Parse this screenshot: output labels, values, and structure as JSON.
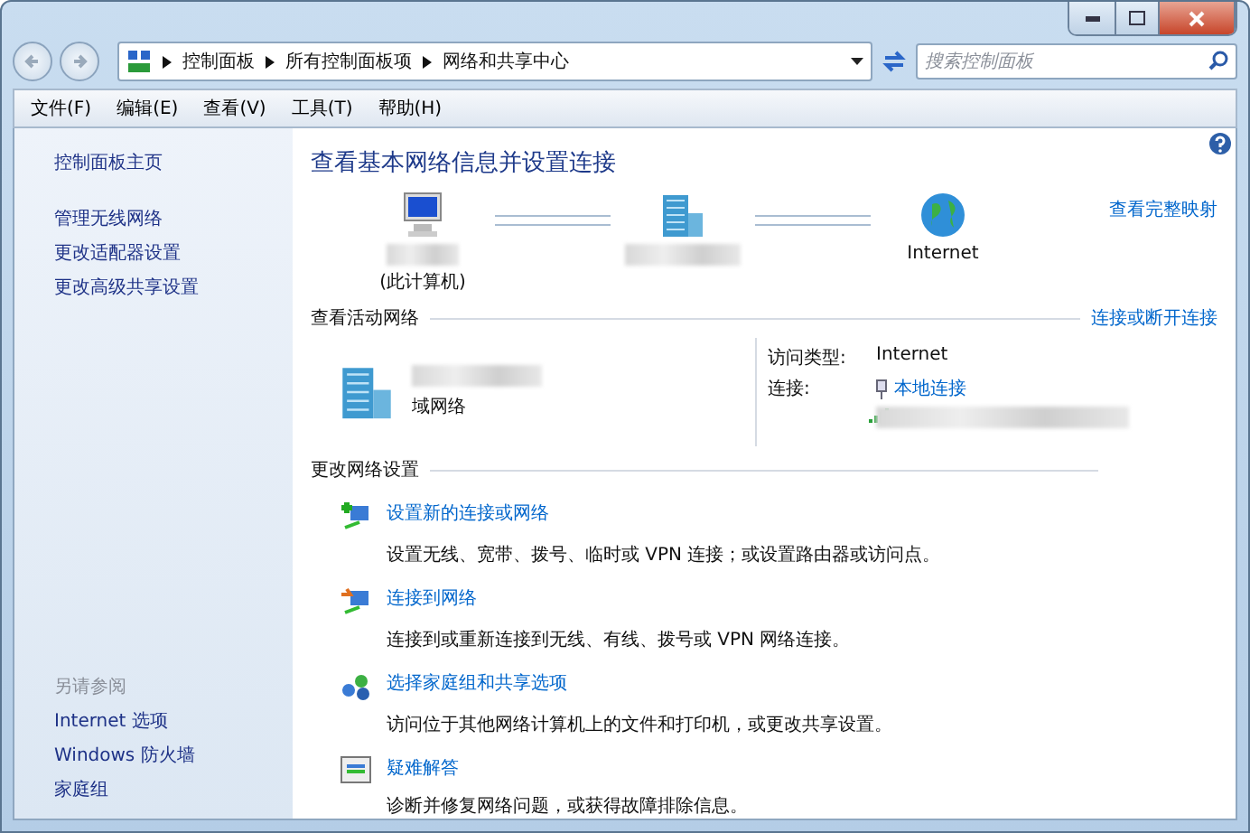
{
  "breadcrumb": [
    "控制面板",
    "所有控制面板项",
    "网络和共享中心"
  ],
  "search": {
    "placeholder": "搜索控制面板"
  },
  "menu": [
    "文件(F)",
    "编辑(E)",
    "查看(V)",
    "工具(T)",
    "帮助(H)"
  ],
  "sidebar": {
    "items": [
      "控制面板主页",
      "管理无线网络",
      "更改适配器设置",
      "更改高级共享设置"
    ],
    "see_also_title": "另请参阅",
    "see_also": [
      "Internet 选项",
      "Windows 防火墙",
      "家庭组"
    ]
  },
  "main": {
    "title": "查看基本网络信息并设置连接",
    "map_link": "查看完整映射",
    "nodes": [
      {
        "kind": "computer",
        "label": "(此计算机)"
      },
      {
        "kind": "network"
      },
      {
        "kind": "internet",
        "label": "Internet"
      }
    ],
    "active_title": "查看活动网络",
    "active_link": "连接或断开连接",
    "network_type": "域网络",
    "access_label": "访问类型:",
    "access_value": "Internet",
    "connection_label": "连接:",
    "connection_value": "本地连接",
    "change_title": "更改网络设置",
    "tasks": [
      {
        "kind": "new",
        "link": "设置新的连接或网络",
        "desc": "设置无线、宽带、拨号、临时或 VPN 连接；或设置路由器或访问点。"
      },
      {
        "kind": "connect",
        "link": "连接到网络",
        "desc": "连接到或重新连接到无线、有线、拨号或 VPN 网络连接。"
      },
      {
        "kind": "homegroup",
        "link": "选择家庭组和共享选项",
        "desc": "访问位于其他网络计算机上的文件和打印机，或更改共享设置。"
      },
      {
        "kind": "troubleshoot",
        "link": "疑难解答",
        "desc": "诊断并修复网络问题，或获得故障排除信息。"
      }
    ]
  }
}
